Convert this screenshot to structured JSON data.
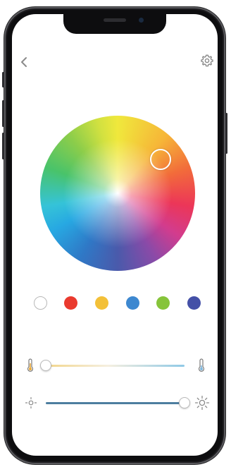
{
  "icons": {
    "back": "chevron-left-icon",
    "settings": "gear-icon",
    "temp_warm": "thermometer-warm-icon",
    "temp_cool": "thermometer-cool-icon",
    "brightness_low": "sun-low-icon",
    "brightness_high": "sun-high-icon"
  },
  "color_wheel": {
    "selected_color": "#f5cf3a"
  },
  "presets": [
    {
      "name": "white",
      "color": "#ffffff"
    },
    {
      "name": "red",
      "color": "#ea3a2e"
    },
    {
      "name": "yellow",
      "color": "#f3c038"
    },
    {
      "name": "blue",
      "color": "#3d88d0"
    },
    {
      "name": "green",
      "color": "#86c43a"
    },
    {
      "name": "indigo",
      "color": "#4450a7"
    }
  ],
  "color_temperature": {
    "level": 0.0,
    "warm_color": "#f2d58a",
    "cool_color": "#8fc9e6"
  },
  "brightness": {
    "level": 1.0,
    "track_color": "#4d7e9f"
  }
}
